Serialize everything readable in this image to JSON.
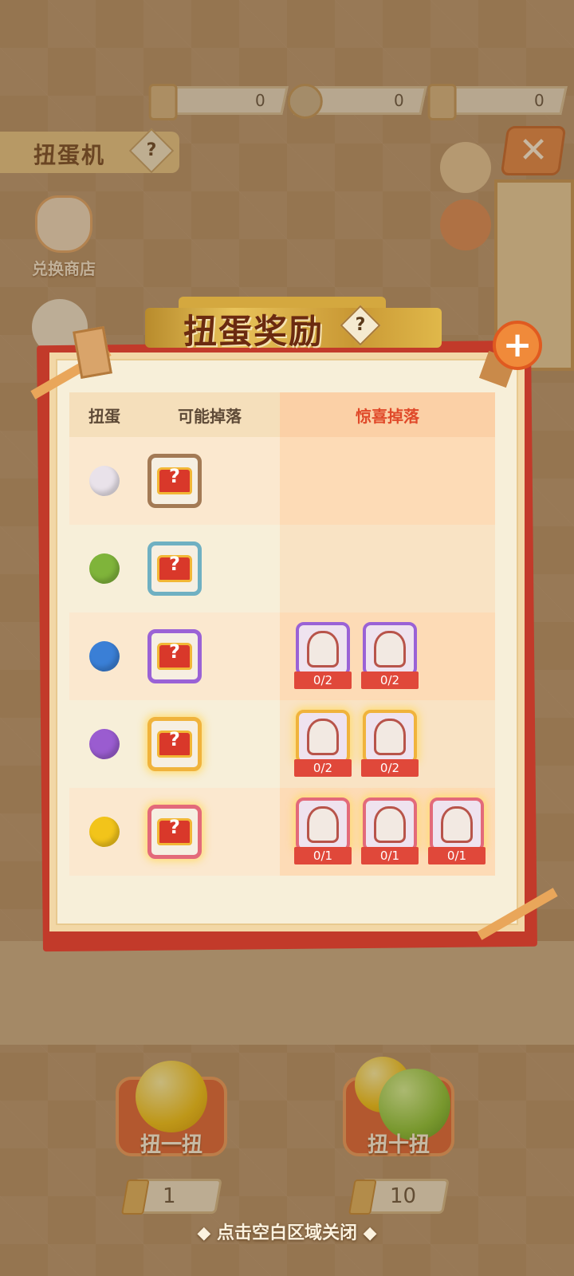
{
  "top_bar": {
    "resources": [
      {
        "icon": "ticket-icon",
        "value": "0"
      },
      {
        "icon": "coin-icon",
        "value": "0"
      },
      {
        "icon": "voucher-icon",
        "value": "0"
      }
    ]
  },
  "machine": {
    "title": "扭蛋机",
    "help_icon": "?",
    "shop_label": "兑换商店",
    "close_glyph": "✕",
    "pull_one": {
      "label": "扭一扭",
      "cost": "1"
    },
    "pull_ten": {
      "label": "扭十扭",
      "cost": "10"
    }
  },
  "dialog": {
    "title": "扭蛋奖励",
    "help_icon": "?",
    "close_glyph": "+",
    "headers": [
      "扭蛋",
      "可能掉落",
      "惊喜掉落"
    ],
    "rows": [
      {
        "egg_color": "#e9e2ea",
        "chest_border": "#a37a55",
        "surprises": []
      },
      {
        "egg_color": "#7fb43a",
        "chest_border": "#6fb0c2",
        "surprises": []
      },
      {
        "egg_color": "#3a7fd6",
        "chest_border": "#9a62d6",
        "surprises": [
          {
            "icon": "figure-ornament-icon",
            "count": "0/2",
            "border": "#9a62d6"
          },
          {
            "icon": "figure-cat-icon",
            "count": "0/2",
            "border": "#9a62d6"
          }
        ]
      },
      {
        "egg_color": "#9a5cd0",
        "chest_border": "#f0b33c",
        "surprises": [
          {
            "icon": "figure-doll-icon",
            "count": "0/2",
            "border": "#f0b33c"
          },
          {
            "icon": "figure-lucky-cat-icon",
            "count": "0/2",
            "border": "#f0b33c"
          }
        ]
      },
      {
        "egg_color": "#f2c41a",
        "chest_border": "#e36a7a",
        "surprises": [
          {
            "icon": "figure-fox-icon",
            "count": "0/1",
            "border": "#e36a7a"
          },
          {
            "icon": "figure-armor-icon",
            "count": "0/1",
            "border": "#e36a7a"
          },
          {
            "icon": "figure-fish-icon",
            "count": "0/1",
            "border": "#e36a7a"
          }
        ]
      }
    ]
  },
  "close_hint": "◆ 点击空白区域关闭 ◆",
  "colors": {
    "accent_red": "#c23a2a",
    "header_red_text": "#e04a2a",
    "count_red": "#e0483a"
  }
}
